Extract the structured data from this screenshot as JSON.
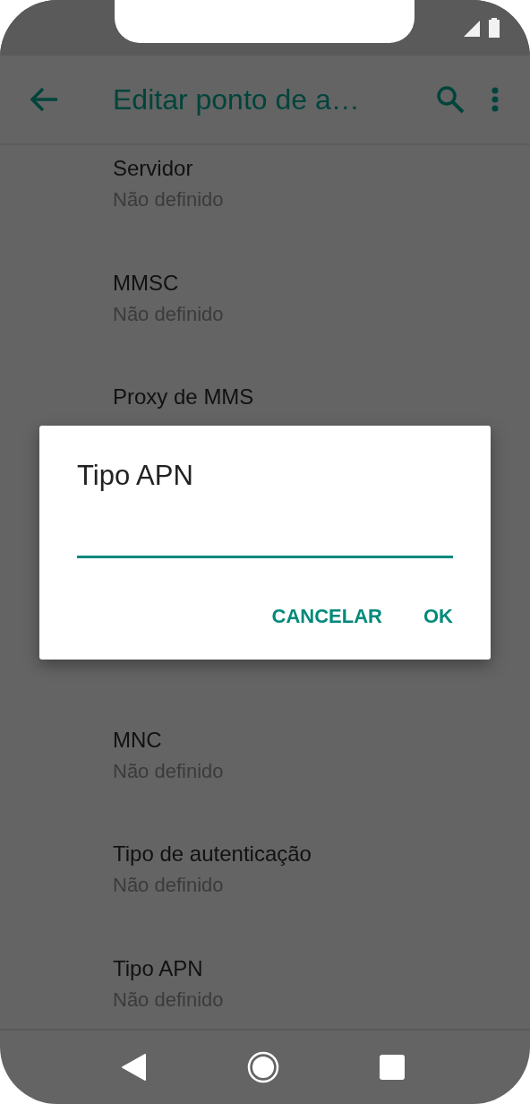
{
  "toolbar": {
    "title": "Editar ponto de a…"
  },
  "settings": [
    {
      "title": "Servidor",
      "subtitle": "Não definido"
    },
    {
      "title": "MMSC",
      "subtitle": "Não definido"
    },
    {
      "title": "Proxy de MMS"
    },
    {
      "title": "MNC",
      "subtitle": "Não definido"
    },
    {
      "title": "Tipo de autenticação",
      "subtitle": "Não definido"
    },
    {
      "title": "Tipo APN",
      "subtitle": "Não definido"
    }
  ],
  "dialog": {
    "title": "Tipo APN",
    "buttons": [
      "CANCELAR",
      "OK"
    ]
  }
}
